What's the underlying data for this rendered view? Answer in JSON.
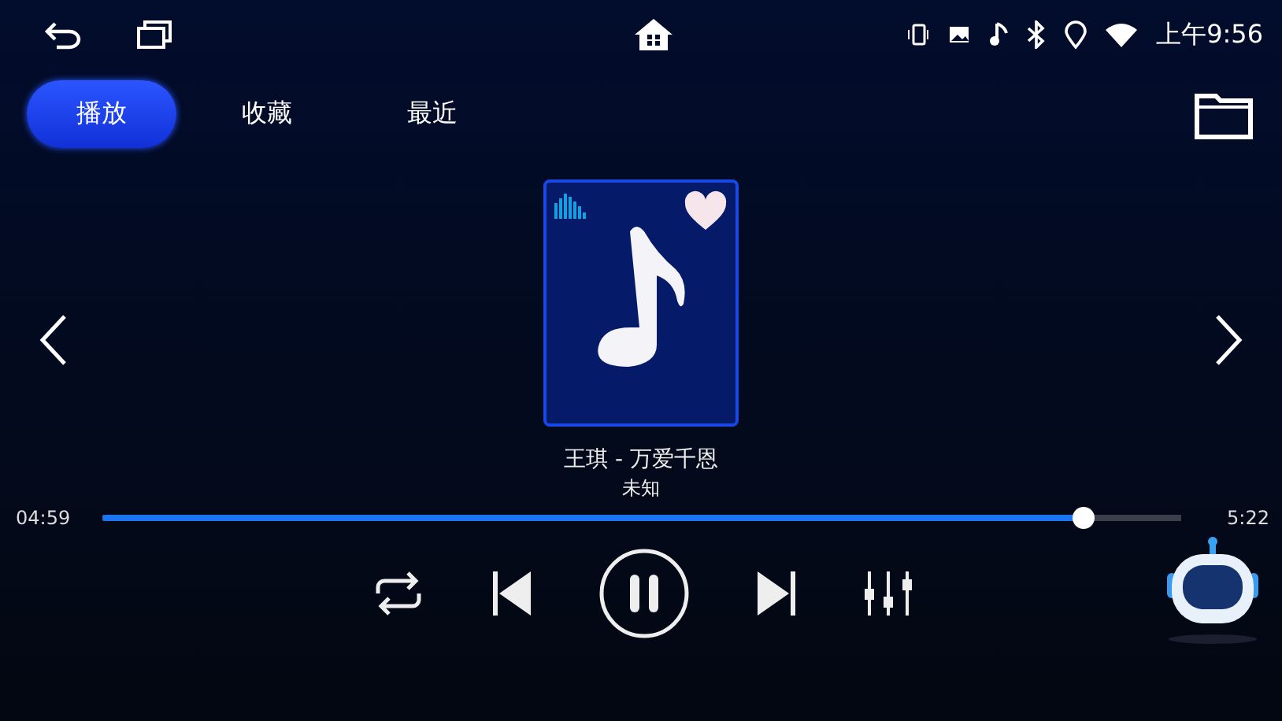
{
  "status_bar": {
    "time": "上午9:56"
  },
  "tabs": [
    {
      "label": "播放",
      "selected": true
    },
    {
      "label": "收藏",
      "selected": false
    },
    {
      "label": "最近",
      "selected": false
    }
  ],
  "track": {
    "title": "王琪 - 万爱千恩",
    "artist": "未知",
    "favorite": true
  },
  "progress": {
    "elapsed": "04:59",
    "total": "5:22",
    "level": 0.91
  },
  "playback": {
    "playing": true
  }
}
